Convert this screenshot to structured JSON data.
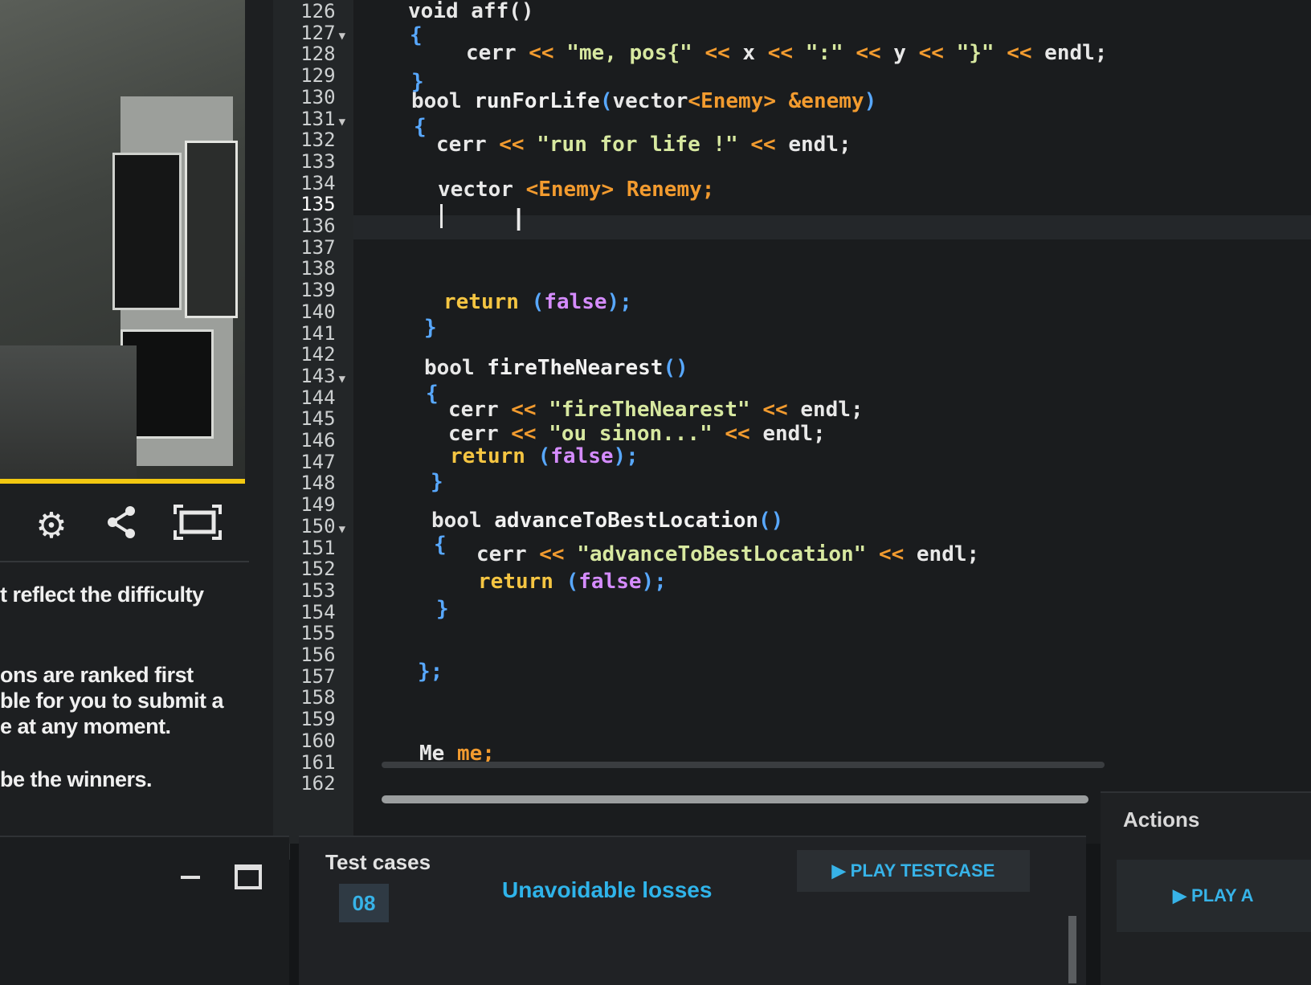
{
  "left_panel": {
    "description_lines": [
      "t reflect the difficulty",
      "",
      "ons are ranked first",
      "ble for you to submit a",
      "e at any moment.",
      "",
      "be the winners."
    ]
  },
  "editor": {
    "line_numbers": [
      "126",
      "127",
      "128",
      "129",
      "130",
      "131",
      "132",
      "133",
      "134",
      "135",
      "136",
      "137",
      "138",
      "139",
      "140",
      "141",
      "142",
      "143",
      "144",
      "145",
      "146",
      "147",
      "148",
      "149",
      "150",
      "151",
      "152",
      "153",
      "154",
      "155",
      "156",
      "157",
      "158",
      "159",
      "160",
      "161",
      "162"
    ],
    "folded_lines": [
      "127",
      "131",
      "143",
      "150"
    ],
    "current_line": "135",
    "code": {
      "l126": "void aff()",
      "l127": "{",
      "l128": {
        "kw": "cerr",
        "s1": "\"me, pos{\"",
        "x": "x",
        "s2": "\":\"",
        "y": "y",
        "s3": "\"}\"",
        "end": "endl;"
      },
      "l129": "}",
      "l130": {
        "kw": "bool",
        "fn": "runForLife",
        "p1": "(",
        "t": "vector",
        "g1": "<",
        "ty": "Enemy",
        "g2": ">",
        "ref": "&enemy",
        "p2": ")"
      },
      "l131": "{",
      "l132": {
        "kw": "cerr",
        "s": "\"run for life !\"",
        "end": "endl;"
      },
      "l134": {
        "kw": "vector",
        "g1": "<",
        "ty": "Enemy",
        "g2": ">",
        "var": "Renemy;"
      },
      "l139": {
        "kw": "return",
        "p1": "(",
        "val": "false",
        "p2": ");"
      },
      "l140": "}",
      "l142": {
        "kw": "bool",
        "fn": "fireTheNearest",
        "p": "()"
      },
      "l143": "{",
      "l144": {
        "kw": "cerr",
        "s": "\"fireTheNearest\"",
        "end": "endl;"
      },
      "l145": {
        "kw": "cerr",
        "s": "\"ou sinon...\"",
        "end": "endl;"
      },
      "l146": {
        "kw": "return",
        "p1": "(",
        "val": "false",
        "p2": ");"
      },
      "l147": "}",
      "l149": {
        "kw": "bool",
        "fn": "advanceToBestLocation",
        "p": "()"
      },
      "l150": "{",
      "l151": {
        "kw": "cerr",
        "s": "\"advanceToBestLocation\"",
        "end": "endl;"
      },
      "l152": {
        "kw": "return",
        "p1": "(",
        "val": "false",
        "p2": ");"
      },
      "l153": "}",
      "l156": "};",
      "l160": {
        "kw": "Me",
        "var": "me;"
      }
    },
    "op": "<<"
  },
  "test_cases": {
    "title": "Test cases",
    "number": "08",
    "name": "Unavoidable losses",
    "play_label": "▶ PLAY TESTCASE"
  },
  "actions": {
    "title": "Actions",
    "play_label": "▶ PLAY A"
  },
  "icons": [
    "settings-icon",
    "share-icon",
    "fullscreen-icon",
    "minimize-icon",
    "maximize-icon"
  ]
}
